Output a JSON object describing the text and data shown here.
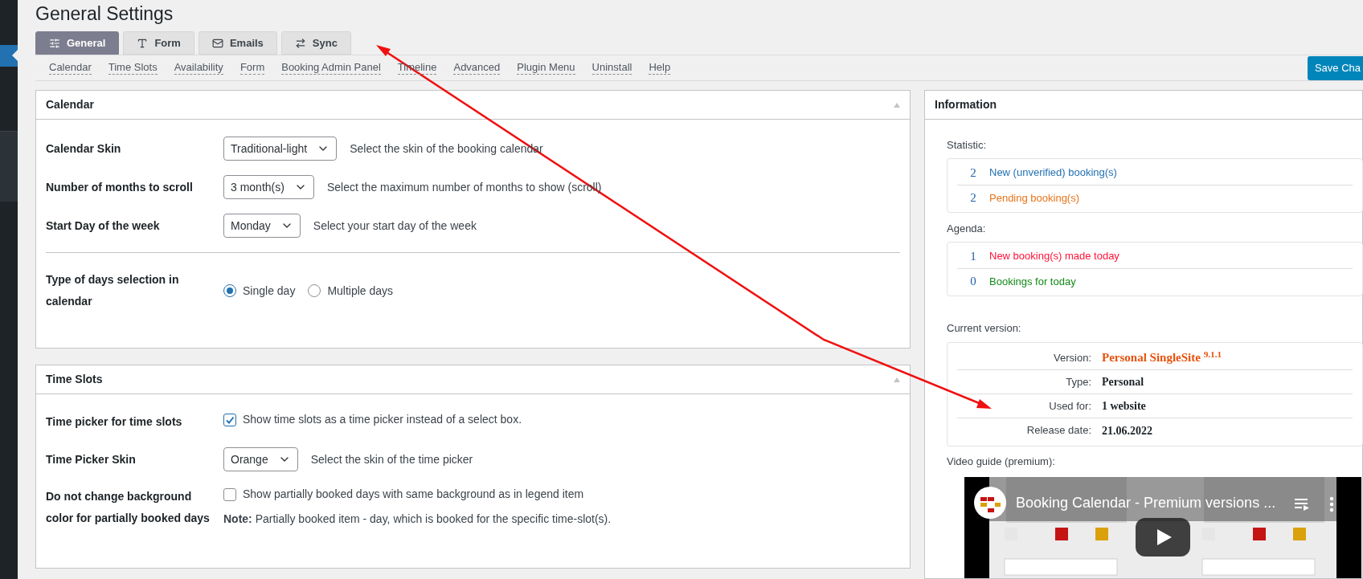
{
  "page": {
    "title": "General Settings"
  },
  "tabs": [
    {
      "label": "General",
      "selected": true
    },
    {
      "label": "Form",
      "selected": false
    },
    {
      "label": "Emails",
      "selected": false
    },
    {
      "label": "Sync",
      "selected": false
    }
  ],
  "subnav": [
    "Calendar",
    "Time Slots",
    "Availability",
    "Form",
    "Booking Admin Panel",
    "Timeline",
    "Advanced",
    "Plugin Menu",
    "Uninstall",
    "Help"
  ],
  "save_button": "Save Cha",
  "panels": [
    {
      "title": "Calendar",
      "rows": [
        {
          "kind": "select",
          "label": "Calendar Skin",
          "value": "Traditional-light",
          "help": "Select the skin of the booking calendar",
          "separated": false
        },
        {
          "kind": "select",
          "label": "Number of months to scroll",
          "value": "3 month(s)",
          "help": "Select the maximum number of months to show (scroll)",
          "separated": false
        },
        {
          "kind": "select",
          "label": "Start Day of the week",
          "value": "Monday",
          "help": "Select your start day of the week",
          "separated": false
        },
        {
          "kind": "radio",
          "label": "Type of days selection in calendar",
          "separated": true,
          "options": [
            {
              "label": "Single day",
              "selected": true
            },
            {
              "label": "Multiple days",
              "selected": false
            }
          ]
        }
      ]
    },
    {
      "title": "Time Slots",
      "rows": [
        {
          "kind": "checkbox",
          "label": "Time picker for time slots",
          "checked": true,
          "text": "Show time slots as a time picker instead of a select box.",
          "separated": false
        },
        {
          "kind": "select",
          "label": "Time Picker Skin",
          "value": "Orange",
          "help": "Select the skin of the time picker",
          "separated": false
        },
        {
          "kind": "checkbox",
          "label": "Do not change background color for partially booked days",
          "checked": false,
          "text": "Show partially booked days with same background as in legend item",
          "note": "**Note:** Partially booked item - day, which is booked for the specific time-slot(s).",
          "separated": false
        }
      ]
    }
  ],
  "information": {
    "title": "Information",
    "groups": [
      {
        "heading": "Statistic:",
        "items": [
          {
            "count": "2",
            "text": "New (unverified) booking(s)",
            "color": "#2271b1"
          },
          {
            "count": "2",
            "text": "Pending booking(s)",
            "color": "#e8731a"
          }
        ]
      },
      {
        "heading": "Agenda:",
        "items": [
          {
            "count": "1",
            "text": "New booking(s) made today",
            "color": "#ff1238"
          },
          {
            "count": "0",
            "text": "Bookings for today",
            "color": "#138a17"
          }
        ]
      }
    ],
    "version": {
      "heading": "Current version:",
      "rows": [
        {
          "label": "Version:",
          "value": "Personal SingleSite $^{9.1.1}$",
          "kind": "highlight"
        },
        {
          "label": "Type:",
          "value": "Personal",
          "kind": "plain"
        },
        {
          "label": "Used for:",
          "value": "1 website",
          "kind": "plain"
        },
        {
          "label": "Release date:",
          "value": "21.06.2022",
          "kind": "plain"
        }
      ]
    },
    "video": {
      "heading": "Video guide (premium):",
      "title": "Booking Calendar - Premium versions ..."
    }
  }
}
